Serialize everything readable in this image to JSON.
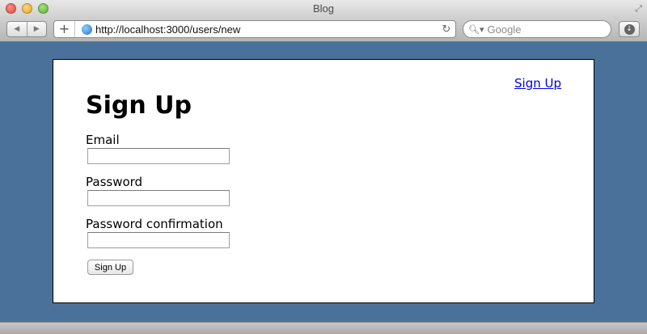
{
  "window": {
    "title": "Blog"
  },
  "toolbar": {
    "back_icon": "◀",
    "forward_icon": "▶",
    "add_icon": "+",
    "url": "http://localhost:3000/users/new",
    "reload_icon": "↻",
    "search_placeholder": "Google",
    "search_icon": "🔍︎▾",
    "download_icon": "↓"
  },
  "page": {
    "header_link": "Sign Up",
    "title": "Sign Up",
    "fields": [
      {
        "label": "Email",
        "value": ""
      },
      {
        "label": "Password",
        "value": ""
      },
      {
        "label": "Password confirmation",
        "value": ""
      }
    ],
    "submit_label": "Sign Up"
  },
  "colors": {
    "page_background": "#4a7199",
    "link": "#0000ee"
  }
}
